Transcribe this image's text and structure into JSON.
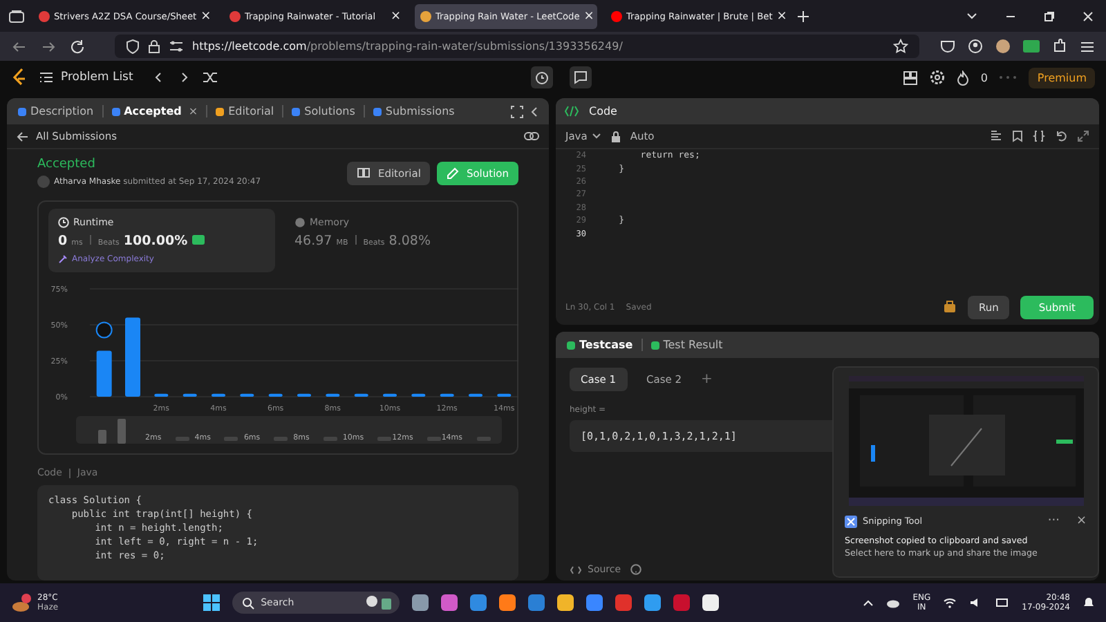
{
  "browser": {
    "tabs": [
      {
        "title": "Strivers A2Z DSA Course/Sheet",
        "close": "×",
        "selected": false
      },
      {
        "title": "Trapping Rainwater - Tutorial",
        "close": "×",
        "selected": false
      },
      {
        "title": "Trapping Rain Water - LeetCode",
        "close": "×",
        "selected": true
      },
      {
        "title": "Trapping Rainwater | Brute | Bet",
        "close": "×",
        "selected": false
      }
    ],
    "url": {
      "host": "https://leetcode.com",
      "path": "/problems/trapping-rain-water/submissions/1393356249/"
    }
  },
  "nav": {
    "problem_list": "Problem List",
    "streak": "0",
    "premium": "Premium"
  },
  "left_panel": {
    "tabs": [
      {
        "label": "Description",
        "selected": false
      },
      {
        "label": "Accepted",
        "close": "×",
        "selected": true
      },
      {
        "label": "Editorial",
        "selected": false
      },
      {
        "label": "Solutions",
        "selected": false
      },
      {
        "label": "Submissions",
        "selected": false
      }
    ],
    "back_link": "All Submissions",
    "status": "Accepted",
    "author": "Atharva Mhaske",
    "submitted": "submitted at Sep 17, 2024 20:47",
    "buttons": [
      "Editorial",
      "Solution"
    ],
    "runtime": {
      "label": "Runtime",
      "value": "0",
      "unit": "ms",
      "beats_label": "Beats",
      "beats": "100.00%",
      "analyze": "Analyze Complexity"
    },
    "memory": {
      "label": "Memory",
      "value": "46.97",
      "unit": "MB",
      "beats_label": "Beats",
      "beats": "8.08%"
    },
    "chart_data": {
      "type": "bar",
      "categories": [
        null,
        null,
        "2ms",
        null,
        "4ms",
        null,
        "6ms",
        null,
        "8ms",
        null,
        "10ms",
        null,
        "12ms",
        null,
        "14ms"
      ],
      "values": [
        32,
        55,
        2,
        2,
        2,
        2,
        2,
        2,
        2,
        2,
        2,
        2,
        2,
        2,
        2
      ],
      "ylim": [
        0,
        75
      ],
      "yticks": [
        {
          "value": 0,
          "label": "0%"
        },
        {
          "value": 25,
          "label": "25%"
        },
        {
          "value": 50,
          "label": "50%"
        },
        {
          "value": 75,
          "label": "75%"
        }
      ]
    },
    "navigator_labels": [
      "2ms",
      "4ms",
      "6ms",
      "8ms",
      "10ms",
      "12ms",
      "14ms"
    ],
    "code_label": "Code",
    "code_language": "Java",
    "code": [
      "class Solution {",
      "    public int trap(int[] height) {",
      "        int n = height.length;",
      "        int left = 0, right = n - 1;",
      "        int res = 0;"
    ]
  },
  "editor": {
    "title": "Code",
    "language": "Java",
    "mode": "Auto",
    "lines": [
      {
        "number": "24",
        "text": "        return res;",
        "current": false
      },
      {
        "number": "25",
        "text": "    }",
        "current": false
      },
      {
        "number": "26",
        "current": false
      },
      {
        "number": "27",
        "current": false
      },
      {
        "number": "28",
        "current": false
      },
      {
        "number": "29",
        "text": "    }",
        "current": false
      },
      {
        "number": "30",
        "current": true
      }
    ],
    "position": "Ln 30, Col 1",
    "saved": "Saved",
    "run": "Run",
    "submit": "Submit"
  },
  "testcase": {
    "tabs": [
      {
        "label": "Testcase",
        "selected": true
      },
      {
        "label": "Test Result",
        "selected": false
      }
    ],
    "cases": [
      {
        "label": "Case 1",
        "selected": true
      },
      {
        "label": "Case 2",
        "selected": false
      }
    ],
    "add": "+",
    "param": "height =",
    "value": "[0,1,0,2,1,0,1,3,2,1,2,1]",
    "source": "Source"
  },
  "notification": {
    "app": "Snipping Tool",
    "title": "Screenshot copied to clipboard and saved",
    "body": "Select here to mark up and share the image",
    "more": "···",
    "close": "×"
  },
  "taskbar": {
    "temperature": "28°C",
    "weather": "Haze",
    "search": "Search",
    "lang": "ENG",
    "region": "IN",
    "time": "20:48",
    "date": "17-09-2024"
  }
}
